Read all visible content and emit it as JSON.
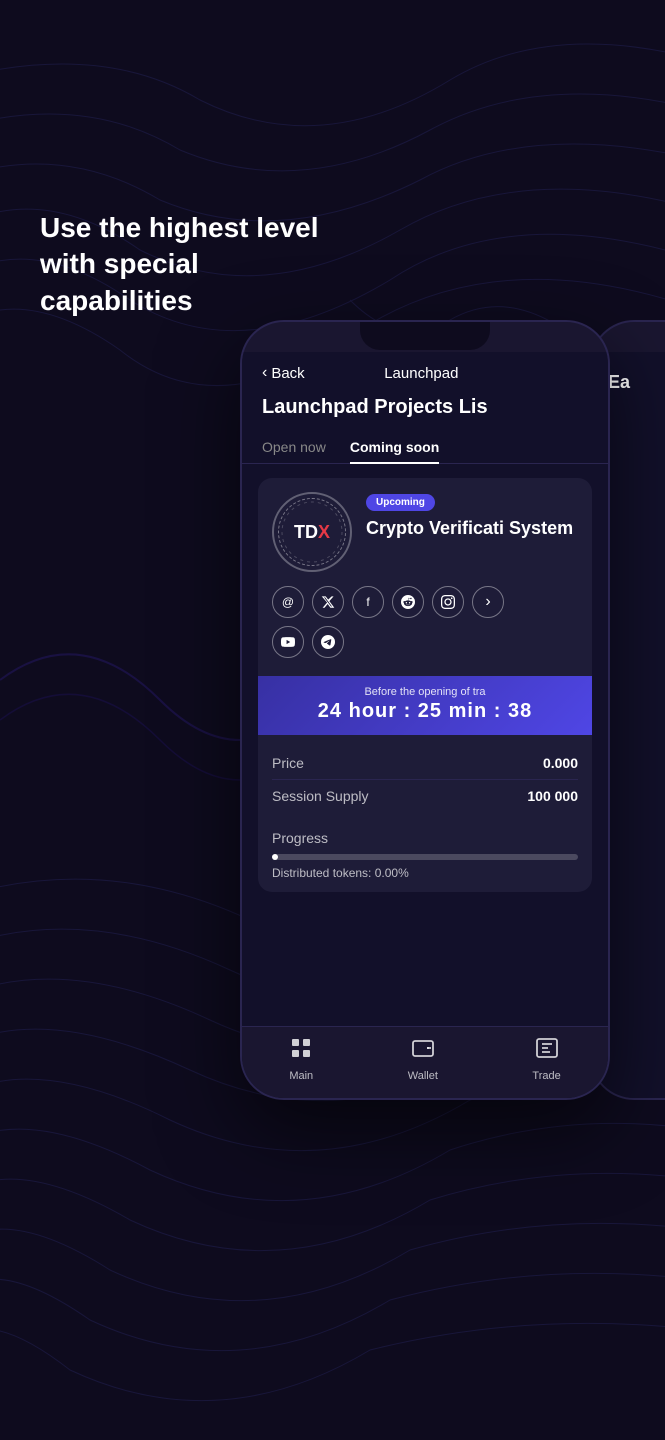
{
  "background": {
    "color": "#0e0b1e"
  },
  "hero": {
    "text": "Use the highest level with special capabilities"
  },
  "phone": {
    "header": {
      "back_label": "Back",
      "title": "Launchpad"
    },
    "page_title": "Launchpad Projects Lis",
    "tabs": [
      {
        "label": "Open now",
        "active": false
      },
      {
        "label": "Coming soon",
        "active": true
      }
    ],
    "project": {
      "badge": "Upcoming",
      "name": "Crypto Verificati System",
      "logo_text": "TDX",
      "social_icons": [
        "@",
        "𝕏",
        "f",
        "r",
        "📷",
        "▶",
        "✈"
      ],
      "timer": {
        "label": "Before the opening of tra",
        "value": "24 hour : 25 min : 38"
      },
      "price_label": "Price",
      "price_value": "0.000",
      "supply_label": "Session Supply",
      "supply_value": "100 000",
      "progress_label": "Progress",
      "progress_percent": 2,
      "distributed_label": "Distributed tokens: 0.00%"
    },
    "nav": [
      {
        "icon": "⊞",
        "label": "Main"
      },
      {
        "icon": "▣",
        "label": "Wallet"
      },
      {
        "icon": "⇄",
        "label": "Trade"
      }
    ]
  },
  "second_phone": {
    "partial_text": "Ea"
  }
}
